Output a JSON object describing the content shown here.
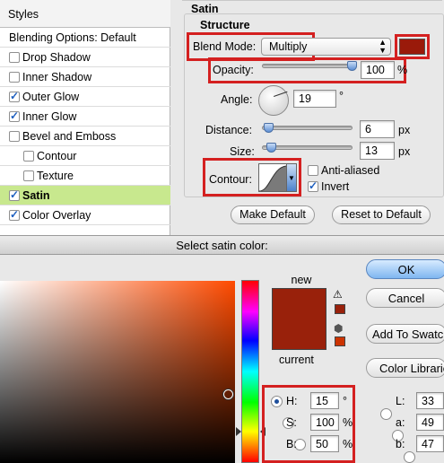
{
  "styles_panel": {
    "header": "Styles",
    "items": [
      {
        "label": "Blending Options: Default",
        "checkbox": false,
        "checked": false,
        "selected": false,
        "indent": false
      },
      {
        "label": "Drop Shadow",
        "checkbox": true,
        "checked": false,
        "selected": false,
        "indent": false
      },
      {
        "label": "Inner Shadow",
        "checkbox": true,
        "checked": false,
        "selected": false,
        "indent": false
      },
      {
        "label": "Outer Glow",
        "checkbox": true,
        "checked": true,
        "selected": false,
        "indent": false
      },
      {
        "label": "Inner Glow",
        "checkbox": true,
        "checked": true,
        "selected": false,
        "indent": false
      },
      {
        "label": "Bevel and Emboss",
        "checkbox": true,
        "checked": false,
        "selected": false,
        "indent": false
      },
      {
        "label": "Contour",
        "checkbox": true,
        "checked": false,
        "selected": false,
        "indent": true
      },
      {
        "label": "Texture",
        "checkbox": true,
        "checked": false,
        "selected": false,
        "indent": true
      },
      {
        "label": "Satin",
        "checkbox": true,
        "checked": true,
        "selected": true,
        "indent": false
      },
      {
        "label": "Color Overlay",
        "checkbox": true,
        "checked": true,
        "selected": false,
        "indent": false
      }
    ]
  },
  "satin": {
    "section_title": "Satin",
    "group_title": "Structure",
    "blend_mode": {
      "label": "Blend Mode:",
      "value": "Multiply",
      "swatch_color": "#9a1a0a"
    },
    "opacity": {
      "label": "Opacity:",
      "value": "100",
      "unit": "%",
      "level": 1.0
    },
    "angle": {
      "label": "Angle:",
      "value": "19",
      "unit": "°"
    },
    "distance": {
      "label": "Distance:",
      "value": "6",
      "unit": "px",
      "level": 0.02
    },
    "size": {
      "label": "Size:",
      "value": "13",
      "unit": "px",
      "level": 0.05
    },
    "contour": {
      "label": "Contour:"
    },
    "anti_aliased": {
      "label": "Anti-aliased",
      "checked": false
    },
    "invert": {
      "label": "Invert",
      "checked": true
    },
    "make_default": "Make Default",
    "reset_default": "Reset to Default"
  },
  "picker": {
    "title": "Select satin color:",
    "new_label": "new",
    "current_label": "current",
    "new_color": "#99210b",
    "current_color": "#99210b",
    "warn_swatch": "#99210b",
    "web_swatch": "#cc3300",
    "ok": "OK",
    "cancel": "Cancel",
    "add_swatches": "Add To Swatches",
    "color_libraries": "Color Libraries",
    "hsb": [
      {
        "label": "H:",
        "value": "15",
        "unit": "°",
        "selected": true
      },
      {
        "label": "S:",
        "value": "100",
        "unit": "%",
        "selected": false
      },
      {
        "label": "B:",
        "value": "50",
        "unit": "%",
        "selected": false
      }
    ],
    "lab": [
      {
        "label": "L:",
        "value": "33"
      },
      {
        "label": "a:",
        "value": "49"
      },
      {
        "label": "b:",
        "value": "47"
      }
    ]
  }
}
